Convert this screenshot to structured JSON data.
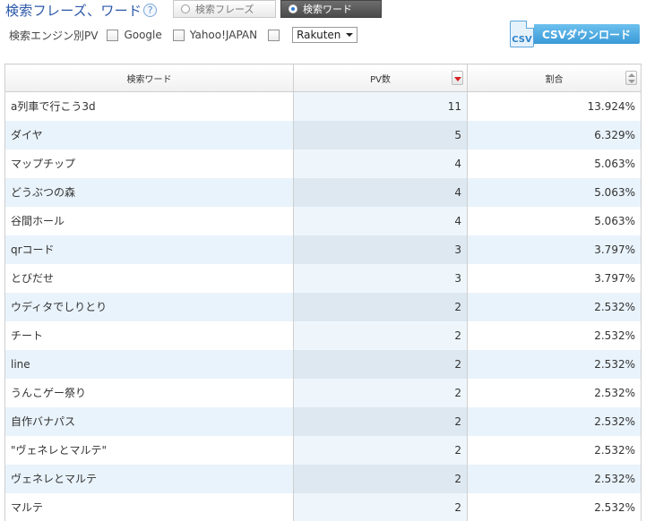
{
  "header": {
    "title": "検索フレーズ、ワード",
    "help_icon": "?",
    "toggle": {
      "phrase_label": "検索フレーズ",
      "word_label": "検索ワード",
      "selected": "word"
    }
  },
  "filter": {
    "label": "検索エンジン別PV",
    "google_label": "Google",
    "yahoo_label": "Yahoo!JAPAN",
    "select_value": "Rakuten"
  },
  "csv": {
    "icon_text": "CSV",
    "label": "CSVダウンロード"
  },
  "table": {
    "columns": [
      "検索ワード",
      "PV数",
      "割合"
    ],
    "rows": [
      {
        "word": "a列車で行こう3d",
        "pv": "11",
        "ratio": "13.924%"
      },
      {
        "word": "ダイヤ",
        "pv": "5",
        "ratio": "6.329%"
      },
      {
        "word": "マップチップ",
        "pv": "4",
        "ratio": "5.063%"
      },
      {
        "word": "どうぶつの森",
        "pv": "4",
        "ratio": "5.063%"
      },
      {
        "word": "谷間ホール",
        "pv": "4",
        "ratio": "5.063%"
      },
      {
        "word": "qrコード",
        "pv": "3",
        "ratio": "3.797%"
      },
      {
        "word": "とびだせ",
        "pv": "3",
        "ratio": "3.797%"
      },
      {
        "word": "ウディタでしりとり",
        "pv": "2",
        "ratio": "2.532%"
      },
      {
        "word": "チート",
        "pv": "2",
        "ratio": "2.532%"
      },
      {
        "word": "line",
        "pv": "2",
        "ratio": "2.532%"
      },
      {
        "word": "うんこゲー祭り",
        "pv": "2",
        "ratio": "2.532%"
      },
      {
        "word": "自作バナパス",
        "pv": "2",
        "ratio": "2.532%"
      },
      {
        "word": "\"ヴェネレとマルテ\"",
        "pv": "2",
        "ratio": "2.532%"
      },
      {
        "word": "ヴェネレとマルテ",
        "pv": "2",
        "ratio": "2.532%"
      },
      {
        "word": "マルテ",
        "pv": "2",
        "ratio": "2.532%"
      }
    ]
  },
  "colors": {
    "title": "#2b57a8",
    "accent": "#3a9ad8",
    "row_alt": "#e9f3fb",
    "sort_active": "#d42020"
  }
}
